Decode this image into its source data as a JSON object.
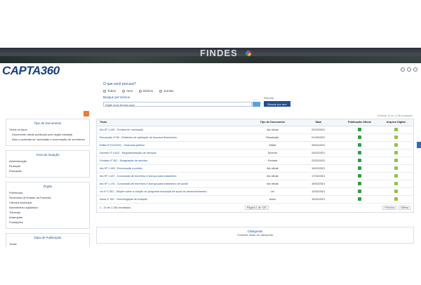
{
  "banner": {
    "text": "FINDES"
  },
  "header": {
    "logo": "CAPTA360"
  },
  "search": {
    "title": "O que você procura?",
    "options": [
      "Todos",
      "Atos",
      "Diários",
      "Jornais"
    ],
    "terms_label": "Busque por termos",
    "input_value": "Digite seus termos aqui",
    "year_label": "Período",
    "year_button": "Buscar por ano"
  },
  "sidebar": {
    "panels": [
      {
        "title": "Tipo de Documento",
        "items": [
          "Todos os tipos",
          "Documento oficial publicado pelo órgão estadual",
          "Atos e portarias de nomeação e exoneração de servidores"
        ]
      },
      {
        "title": "Área de Atuação",
        "items": [
          "Administração",
          "Finanças",
          "Educação"
        ]
      },
      {
        "title": "Órgão",
        "items": [
          "Prefeituras",
          "Secretaria de Estado da Fazenda",
          "Câmara Municipal",
          "Assembleia Legislativa",
          "Tribunais",
          "Autarquias",
          "Fundações"
        ]
      },
      {
        "title": "Data de Publicação",
        "items": [
          "Todas"
        ]
      }
    ]
  },
  "results": {
    "meta": "Exibindo 10 de 1.248 resultados",
    "columns": [
      "Título",
      "Tipo de Documento",
      "Data",
      "Publicação Oficial",
      "Arquivo Digital"
    ],
    "rows": [
      {
        "title": "Ato Nº 1.245 - Portaria de nomeação",
        "type": "Ato oficial",
        "date": "02/03/2021"
      },
      {
        "title": "Resolução nº 88 - Diretrizes de aplicação de recursos financeiros",
        "type": "Resolução",
        "date": "01/03/2021"
      },
      {
        "title": "Edital nº 014/2021 - Chamada pública",
        "type": "Edital",
        "date": "26/02/2021"
      },
      {
        "title": "Decreto nº 4.812 - Regulamentação de serviços",
        "type": "Decreto",
        "date": "24/02/2021"
      },
      {
        "title": "Portaria nº 302 - Designação de servidor",
        "type": "Portaria",
        "date": "22/02/2021"
      },
      {
        "title": "Ato Nº 1.198 - Exoneração a pedido",
        "type": "Ato oficial",
        "date": "19/02/2021"
      },
      {
        "title": "Ato Nº 1.187 - Concessão de benefício e licença para tratamento",
        "type": "Ato oficial",
        "date": "17/02/2021"
      },
      {
        "title": "Ato Nº 1.176 - Concessão de benefício e licença para tratamento de saúde",
        "type": "Ato oficial",
        "date": "15/02/2021"
      },
      {
        "title": "Lei nº 2.301 - Dispõe sobre a criação do programa municipal de apoio ao desenvolvimento",
        "type": "Lei",
        "date": "12/02/2021"
      },
      {
        "title": "Aviso nº 067 - Homologação de licitação",
        "type": "Aviso",
        "date": "10/02/2021"
      }
    ],
    "pager": {
      "left": "1 - 10 de 1.248 resultados",
      "middle": "Página 1 de 125",
      "right": "Próxima",
      "last": "Última"
    }
  },
  "bottom": {
    "title": "Categorias",
    "text": "Consulte todas as categorias"
  },
  "colors": {
    "brand": "#17408b",
    "accent": "#f07a2a",
    "ok": "#2e9e45"
  }
}
